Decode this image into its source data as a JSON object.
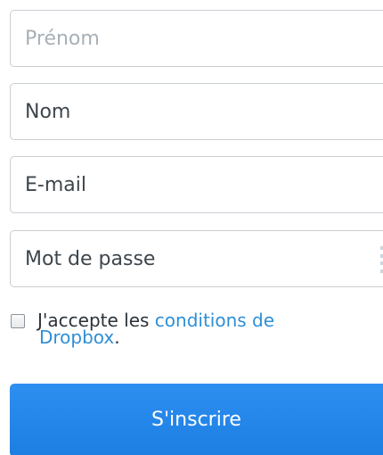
{
  "form": {
    "first_name": {
      "placeholder": "Prénom",
      "value": ""
    },
    "last_name": {
      "placeholder": "Nom",
      "value": ""
    },
    "email": {
      "placeholder": "E-mail",
      "value": ""
    },
    "password": {
      "placeholder": "Mot de passe",
      "value": ""
    },
    "terms": {
      "checked": false,
      "prefix": "J'accepte les ",
      "link_text_1": "conditions de",
      "link_text_2": "Dropbox",
      "suffix": "."
    },
    "submit_label": "S'inscrire"
  },
  "icons": {
    "password_manager": "password-dots-icon"
  },
  "colors": {
    "link": "#2e8fd6",
    "button": "#1d7ee2",
    "border": "#c9ced3",
    "text": "#3d464d",
    "placeholder_muted": "#a7b0b7"
  }
}
